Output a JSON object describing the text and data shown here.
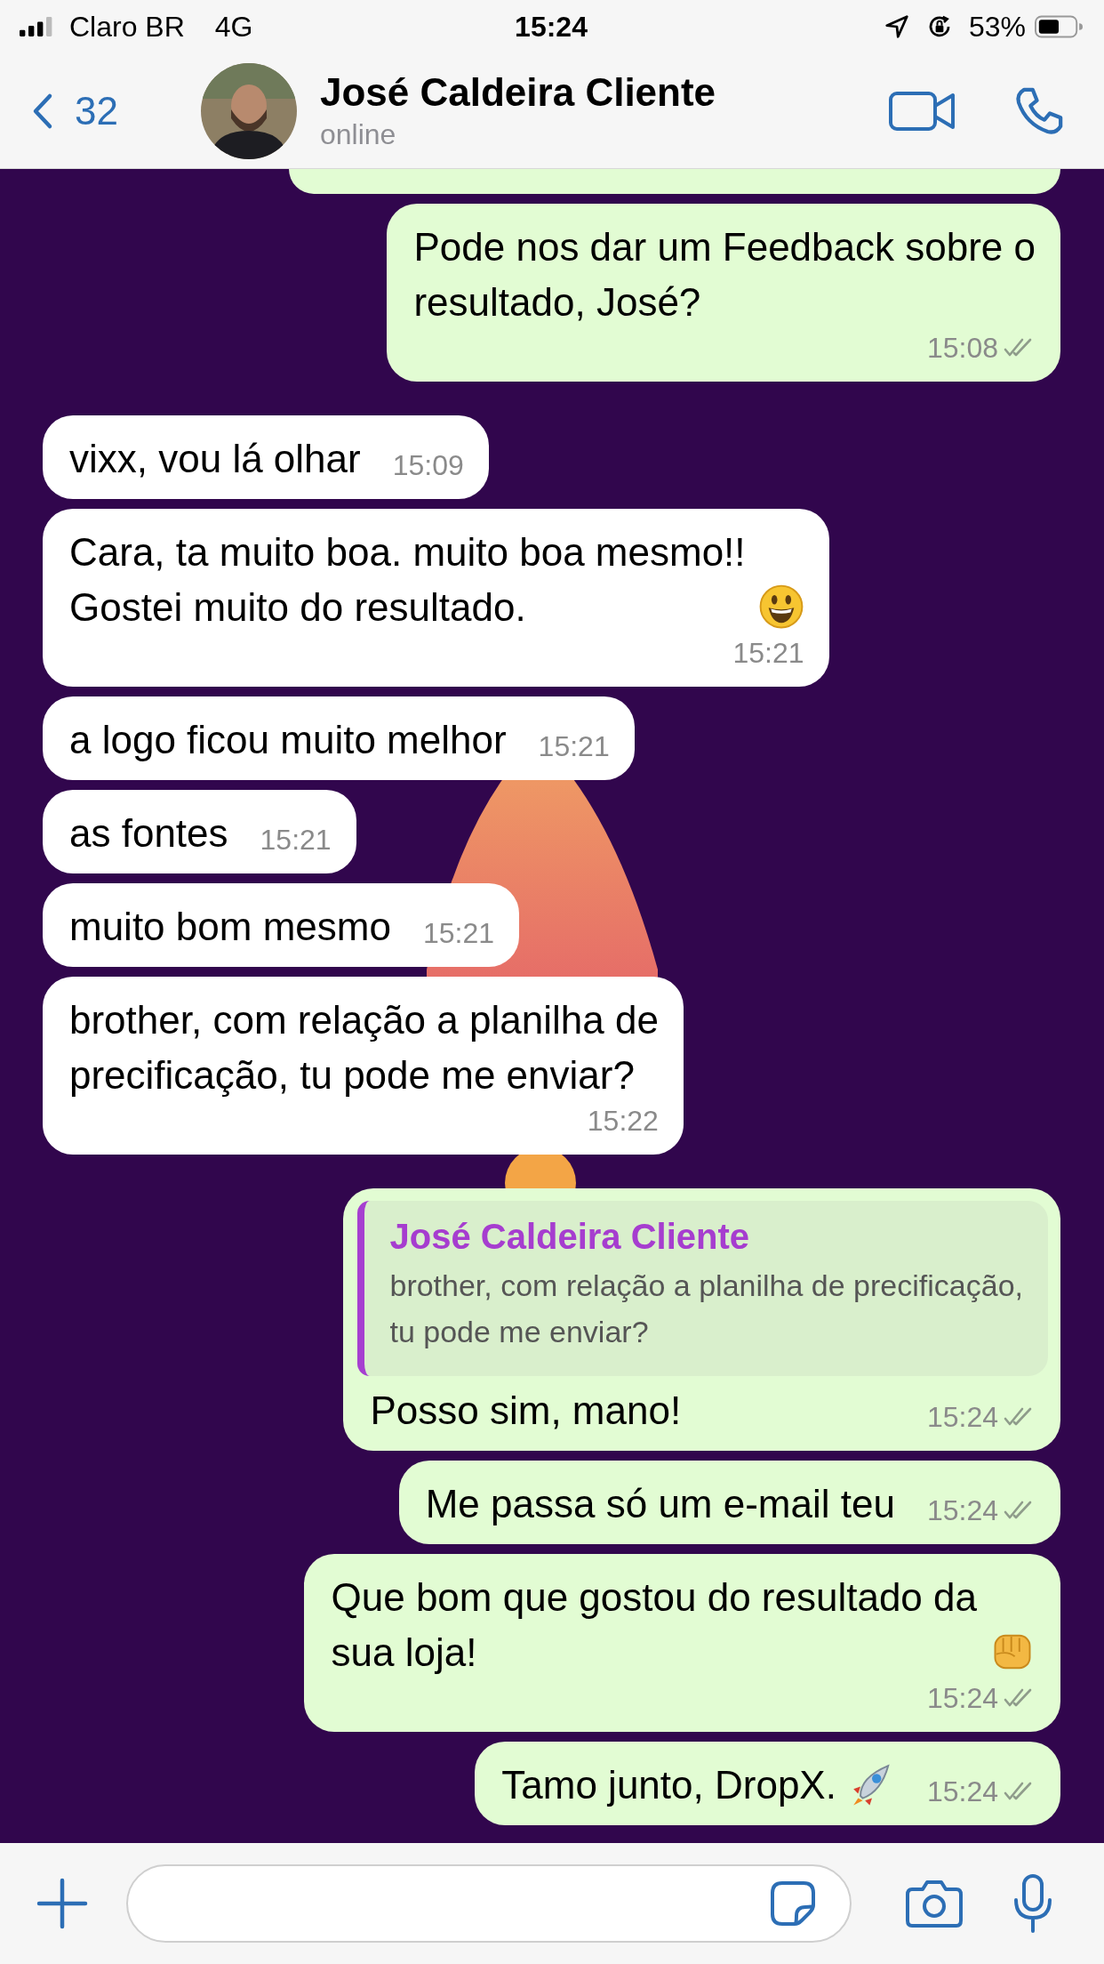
{
  "status_bar": {
    "carrier": "Claro BR",
    "network": "4G",
    "time": "15:24",
    "battery": "53%"
  },
  "header": {
    "back_count": "32",
    "contact_name": "José Caldeira Cliente",
    "presence": "online"
  },
  "messages": [
    {
      "outgoing": true,
      "kind": "text",
      "lines": [
        "Pode nos dar um Feedback sobre o",
        "resultado, José?"
      ],
      "time": "15:08",
      "read": false
    },
    {
      "outgoing": false,
      "kind": "text",
      "lines": [
        "vixx, vou lá olhar"
      ],
      "time": "15:09"
    },
    {
      "outgoing": false,
      "kind": "smiley",
      "lines": [
        "Cara, ta muito boa. muito boa mesmo!!",
        "Gostei muito do resultado."
      ],
      "time": "15:21"
    },
    {
      "outgoing": false,
      "kind": "text",
      "lines": [
        "a logo ficou muito melhor"
      ],
      "time": "15:21"
    },
    {
      "outgoing": false,
      "kind": "text",
      "lines": [
        "as fontes"
      ],
      "time": "15:21"
    },
    {
      "outgoing": false,
      "kind": "text",
      "lines": [
        "muito bom mesmo"
      ],
      "time": "15:21"
    },
    {
      "outgoing": false,
      "kind": "text",
      "lines": [
        "brother, com relação a planilha de",
        "precificação, tu pode me enviar?"
      ],
      "time": "15:22"
    },
    {
      "outgoing": true,
      "kind": "text",
      "quote": {
        "author": "José Caldeira Cliente",
        "lines": [
          "brother, com relação a planilha de precificação,",
          "tu pode me enviar?"
        ]
      },
      "lines": [
        "Posso sim, mano!"
      ],
      "time": "15:24",
      "read": false
    },
    {
      "outgoing": true,
      "kind": "text",
      "lines": [
        "Me passa só um e-mail teu"
      ],
      "time": "15:24",
      "read": false
    },
    {
      "outgoing": true,
      "kind": "fist",
      "lines": [
        "Que bom que gostou do resultado da",
        "sua loja!"
      ],
      "time": "15:24",
      "read": false
    },
    {
      "outgoing": true,
      "kind": "rocket",
      "lines": [
        "Tamo junto, DropX."
      ],
      "time": "15:24",
      "read": false
    }
  ]
}
